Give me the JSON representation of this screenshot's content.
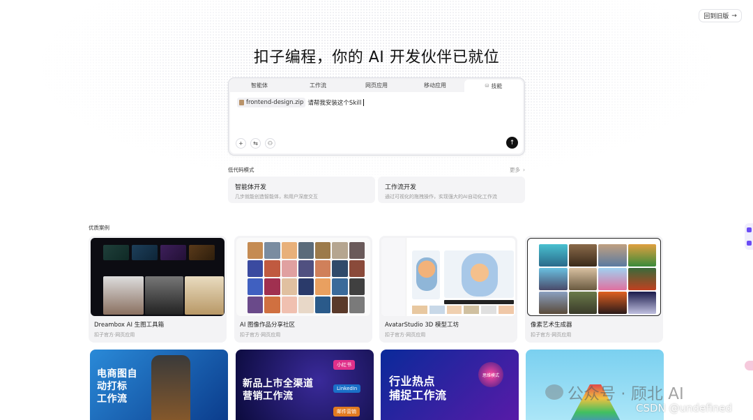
{
  "header": {
    "back_to_old_label": "回到旧版",
    "back_arrow": "→"
  },
  "hero": {
    "title": "扣子编程，你的 AI 开发伙伴已就位"
  },
  "composer": {
    "tabs": [
      {
        "label": "智能体"
      },
      {
        "label": "工作流"
      },
      {
        "label": "网页应用"
      },
      {
        "label": "移动应用"
      },
      {
        "label": "技能",
        "icon": "skill-icon",
        "active": true
      }
    ],
    "skill_tab_glyph": "⛁",
    "file_chip": "frontend-design.zip",
    "prompt_text": "请帮我安装这个Skill",
    "tools": {
      "add": "+",
      "options": "⇆",
      "plugin": "⚇"
    },
    "send_glyph": "↑"
  },
  "lowcode": {
    "heading": "低代码模式",
    "more_label": "更多",
    "more_arrow": "›",
    "cards": [
      {
        "title": "智能体开发",
        "desc": "几步就能创造智能体，和用户深度交互"
      },
      {
        "title": "工作流开发",
        "desc": "通过可视化的拖拽操作，实现强大的AI自动化工作流"
      }
    ]
  },
  "cases": {
    "heading": "优质案例",
    "items": [
      {
        "name": "Dreambox AI 生图工具箱",
        "sub": "扣子官方·网页应用"
      },
      {
        "name": "AI 图像作品分享社区",
        "sub": "扣子官方·网页应用"
      },
      {
        "name": "AvatarStudio 3D 模型工坊",
        "sub": "扣子官方·网页应用"
      },
      {
        "name": "像素艺术生成器",
        "sub": "扣子官方·网页应用"
      }
    ],
    "row2": [
      {
        "text_line1": "电商图自",
        "text_line2": "动打标",
        "text_line3": "工作流"
      },
      {
        "text_line1": "新品上市全渠道",
        "text_line2": "营销工作流",
        "badge1": "小红书",
        "badge2": "LinkedIn",
        "badge3": "邮件营销"
      },
      {
        "text_line1": "行业热点",
        "text_line2": "捕捉工作流",
        "badge1": "思维模式"
      },
      {
        "text_line1": ""
      }
    ]
  },
  "watermarks": {
    "wechat": "公众号 · 顾北 AI",
    "csdn": "CSDN @undefined"
  },
  "colors": {
    "accent": "#6a4cf5",
    "text": "#1f1f1f",
    "muted": "#999999",
    "card_bg": "#f3f3f5"
  }
}
